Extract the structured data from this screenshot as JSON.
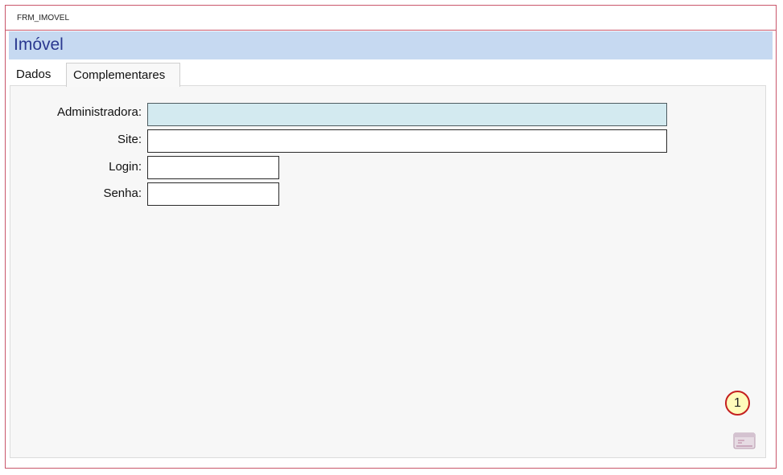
{
  "window": {
    "title": "FRM_IMOVEL"
  },
  "header": {
    "title": "Imóvel"
  },
  "tabs": [
    {
      "label": "Dados",
      "active": false
    },
    {
      "label": "Complementares",
      "active": true
    }
  ],
  "form": {
    "administradora": {
      "label": "Administradora:",
      "value": ""
    },
    "site": {
      "label": "Site:",
      "value": ""
    },
    "login": {
      "label": "Login:",
      "value": ""
    },
    "senha": {
      "label": "Senha:",
      "value": ""
    }
  },
  "callout": {
    "number": "1"
  },
  "icons": {
    "footer": "report-icon"
  },
  "colors": {
    "border": "#c9566a",
    "header_bg": "#c6d9f1",
    "heading": "#2b3990",
    "focused_field": "#d3eaf0"
  }
}
